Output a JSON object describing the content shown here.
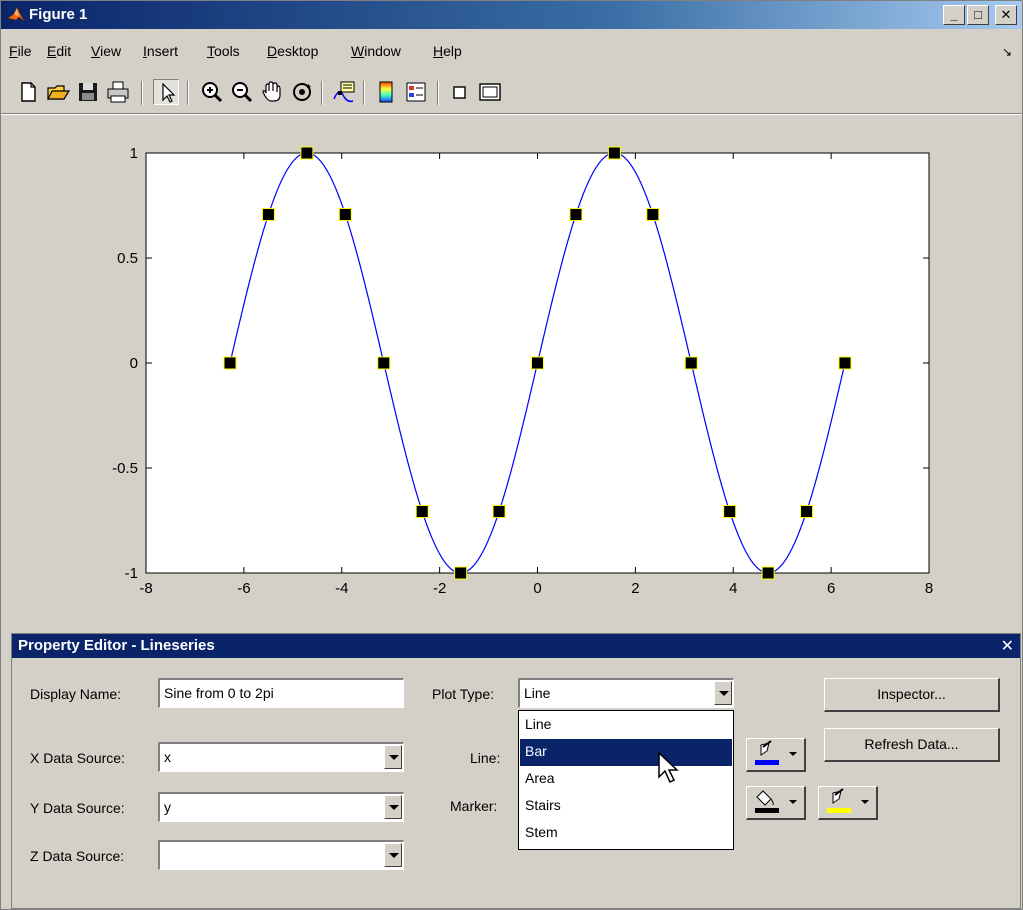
{
  "window": {
    "title": "Figure 1"
  },
  "menubar": {
    "items": [
      {
        "prefix": "",
        "key": "F",
        "rest": "ile"
      },
      {
        "prefix": "",
        "key": "E",
        "rest": "dit"
      },
      {
        "prefix": "",
        "key": "V",
        "rest": "iew"
      },
      {
        "prefix": "",
        "key": "I",
        "rest": "nsert"
      },
      {
        "prefix": "",
        "key": "T",
        "rest": "ools"
      },
      {
        "prefix": "",
        "key": "D",
        "rest": "esktop"
      },
      {
        "prefix": "",
        "key": "W",
        "rest": "indow"
      },
      {
        "prefix": "",
        "key": "H",
        "rest": "elp"
      }
    ],
    "overflow_glyph": "↘"
  },
  "toolbar": {
    "icons": [
      "new-file-icon",
      "open-folder-icon",
      "save-icon",
      "print-icon",
      "edit-plot-arrow-icon",
      "zoom-in-icon",
      "zoom-out-icon",
      "pan-hand-icon",
      "rotate-3d-icon",
      "data-cursor-icon",
      "colorbar-icon",
      "legend-icon",
      "hide-plot-tools-icon",
      "show-plot-tools-icon"
    ]
  },
  "chart_data": {
    "type": "line",
    "title": "",
    "xlabel": "",
    "ylabel": "",
    "xlim": [
      -8,
      8
    ],
    "ylim": [
      -1,
      1
    ],
    "xticks": [
      -8,
      -6,
      -4,
      -2,
      0,
      2,
      4,
      6,
      8
    ],
    "yticks": [
      -1,
      -0.5,
      0,
      0.5,
      1
    ],
    "xtick_labels": [
      "-8",
      "-6",
      "-4",
      "-2",
      "0",
      "2",
      "4",
      "6",
      "8"
    ],
    "ytick_labels": [
      "-1",
      "-0.5",
      "0",
      "0.5",
      "1"
    ],
    "series": [
      {
        "function": "sin",
        "domain": [
          -6.2832,
          6.2832
        ],
        "color": "#0000ff",
        "markers": {
          "shape": "square",
          "face_color": "#000000",
          "edge_color": "#ffff00",
          "x": [
            -6.2832,
            -5.4978,
            -4.7124,
            -3.927,
            -3.1416,
            -2.3562,
            -1.5708,
            -0.7854,
            0,
            0.7854,
            1.5708,
            2.3562,
            3.1416,
            3.927,
            4.7124,
            5.4978,
            6.2832
          ],
          "y": [
            0,
            0.7071,
            1,
            0.7071,
            0,
            -0.7071,
            -1,
            -0.7071,
            0,
            0.7071,
            1,
            0.7071,
            0,
            -0.7071,
            -1,
            -0.7071,
            0
          ]
        }
      }
    ],
    "grid": false,
    "box": true
  },
  "property_editor": {
    "title": "Property Editor - Lineseries",
    "close_glyph": "✕",
    "display_name_label": "Display Name:",
    "display_name_value": "Sine from 0 to 2pi",
    "x_source_label": "X Data Source:",
    "x_source_value": "x",
    "y_source_label": "Y Data Source:",
    "y_source_value": "y",
    "z_source_label": "Z Data Source:",
    "z_source_value": "",
    "plot_type_label": "Plot Type:",
    "plot_type_value": "Line",
    "plot_type_options": [
      "Line",
      "Bar",
      "Area",
      "Stairs",
      "Stem"
    ],
    "plot_type_highlighted": "Bar",
    "line_label": "Line:",
    "marker_label": "Marker:",
    "inspector_button": "Inspector...",
    "refresh_button": "Refresh Data...",
    "line_color": "#0000ff"
  }
}
